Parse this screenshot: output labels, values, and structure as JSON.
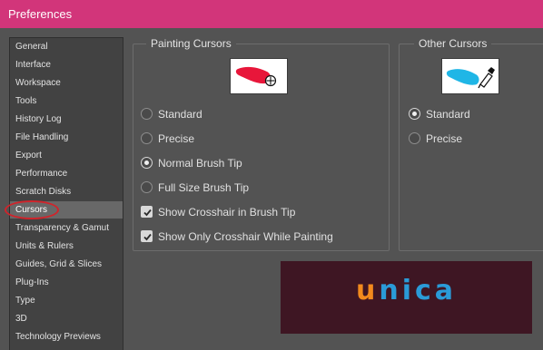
{
  "window": {
    "title": "Preferences"
  },
  "sidebar": {
    "items": [
      {
        "label": "General"
      },
      {
        "label": "Interface"
      },
      {
        "label": "Workspace"
      },
      {
        "label": "Tools"
      },
      {
        "label": "History Log"
      },
      {
        "label": "File Handling"
      },
      {
        "label": "Export"
      },
      {
        "label": "Performance"
      },
      {
        "label": "Scratch Disks"
      },
      {
        "label": "Cursors",
        "selected": true
      },
      {
        "label": "Transparency & Gamut"
      },
      {
        "label": "Units & Rulers"
      },
      {
        "label": "Guides, Grid & Slices"
      },
      {
        "label": "Plug-Ins"
      },
      {
        "label": "Type"
      },
      {
        "label": "3D"
      },
      {
        "label": "Technology Previews"
      }
    ]
  },
  "painting_cursors": {
    "legend": "Painting Cursors",
    "preview_stroke_color": "#e8163a",
    "options": [
      {
        "label": "Standard",
        "type": "radio",
        "checked": false
      },
      {
        "label": "Precise",
        "type": "radio",
        "checked": false
      },
      {
        "label": "Normal Brush Tip",
        "type": "radio",
        "checked": true
      },
      {
        "label": "Full Size Brush Tip",
        "type": "radio",
        "checked": false
      },
      {
        "label": "Show Crosshair in Brush Tip",
        "type": "checkbox",
        "checked": true
      },
      {
        "label": "Show Only Crosshair While Painting",
        "type": "checkbox",
        "checked": true
      }
    ]
  },
  "other_cursors": {
    "legend": "Other Cursors",
    "preview_stroke_color": "#1fb6e6",
    "options": [
      {
        "label": "Standard",
        "type": "radio",
        "checked": true
      },
      {
        "label": "Precise",
        "type": "radio",
        "checked": false
      }
    ]
  },
  "watermark": {
    "text": "unica",
    "letter_colors": [
      "#f28a1d",
      "#2a9bd8",
      "#2a9bd8",
      "#2a9bd8",
      "#2a9bd8"
    ],
    "dot_color": "#2a9bd8"
  }
}
